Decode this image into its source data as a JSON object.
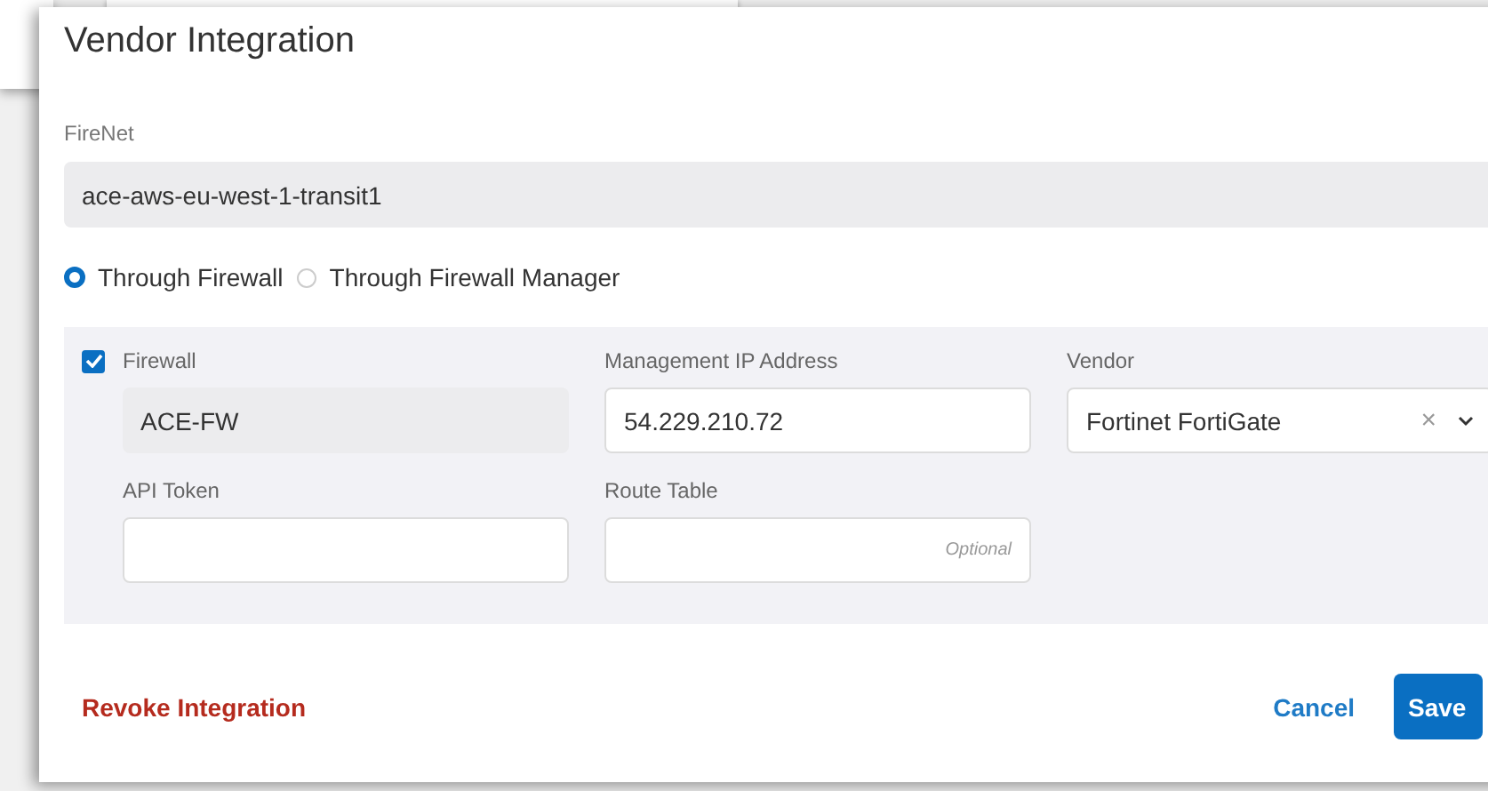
{
  "dialog": {
    "title": "Vendor Integration"
  },
  "firenet": {
    "label": "FireNet",
    "value": "ace-aws-eu-west-1-transit1"
  },
  "modes": [
    {
      "label": "Through Firewall",
      "selected": true
    },
    {
      "label": "Through Firewall Manager",
      "selected": false
    }
  ],
  "firewall": {
    "label": "Firewall",
    "checked": true,
    "value": "ACE-FW"
  },
  "management_ip": {
    "label": "Management IP Address",
    "value": "54.229.210.72"
  },
  "vendor": {
    "label": "Vendor",
    "value": "Fortinet FortiGate",
    "clear": "×"
  },
  "api_token": {
    "label": "API Token"
  },
  "route_table": {
    "label": "Route Table",
    "placeholder": "Optional"
  },
  "footer": {
    "revoke": "Revoke Integration",
    "cancel": "Cancel",
    "save": "Save"
  }
}
